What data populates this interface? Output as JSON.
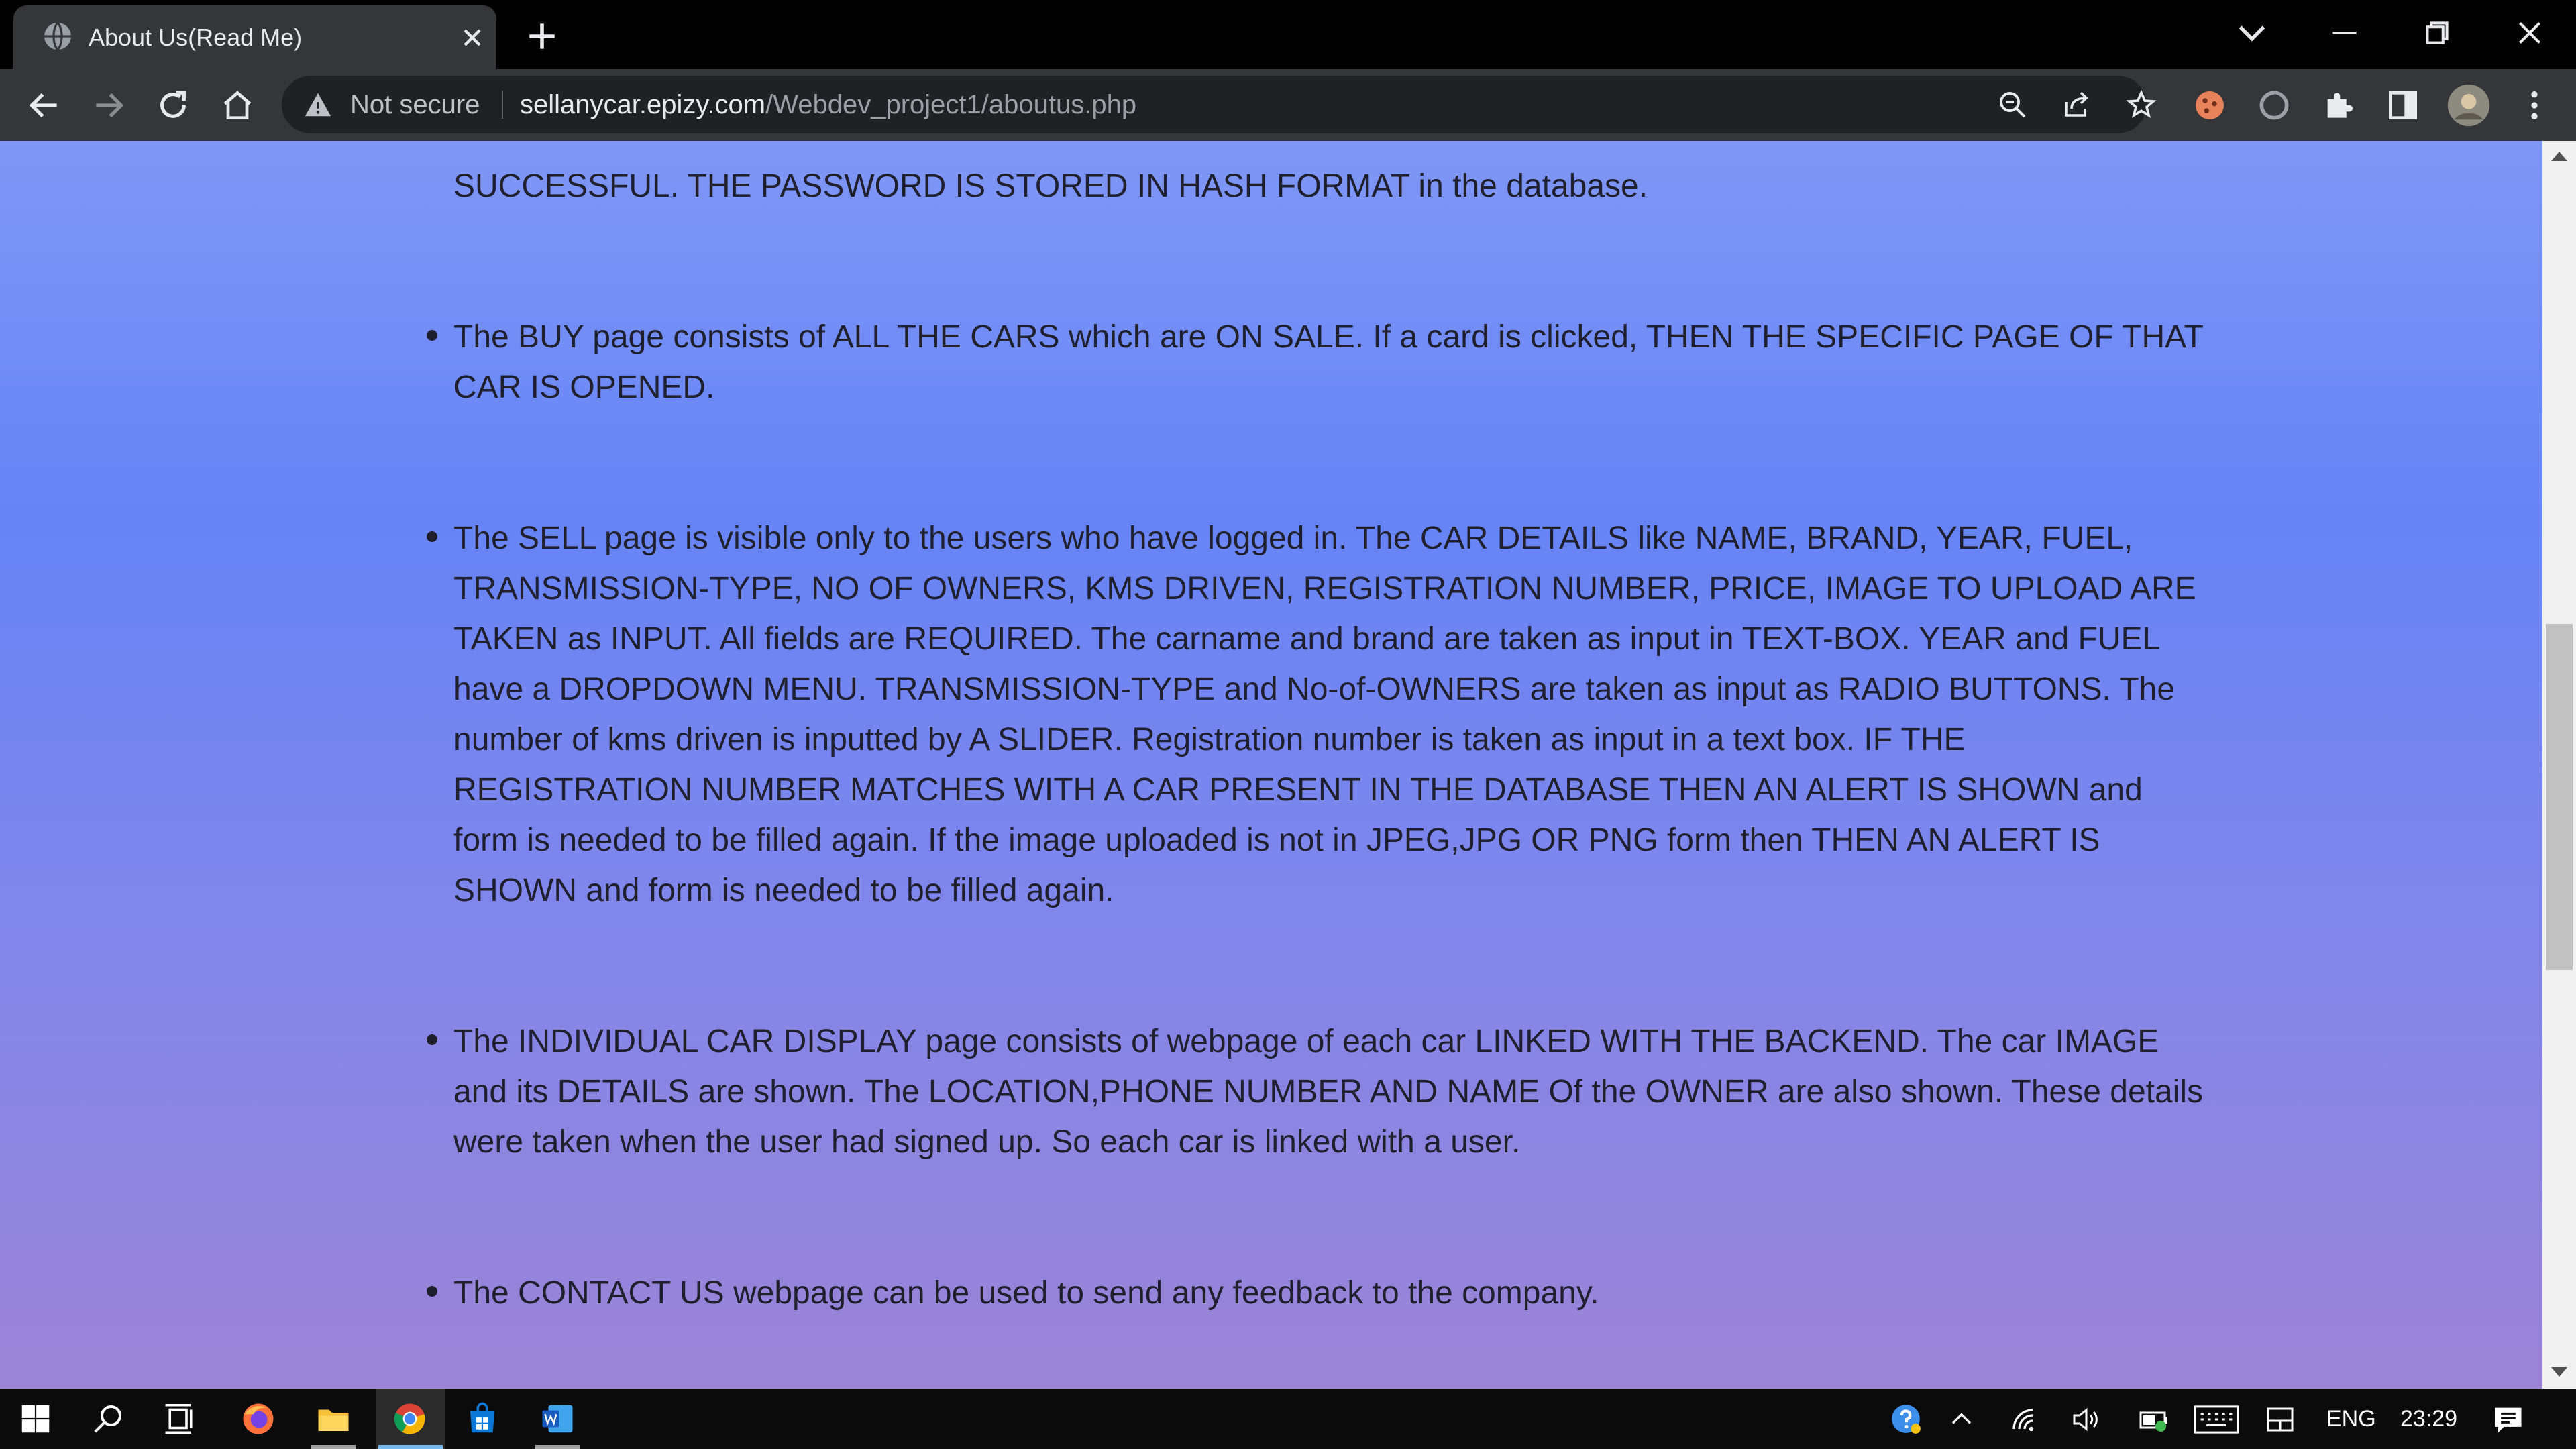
{
  "browser": {
    "tab": {
      "title": "About Us(Read Me)",
      "favicon": "globe-icon"
    },
    "new_tab_icon": "plus-icon",
    "window_controls": [
      "chevron-down-icon",
      "minimize-icon",
      "restore-icon",
      "close-icon"
    ],
    "toolbar": {
      "nav_icons": [
        "back-arrow-icon",
        "forward-arrow-icon",
        "reload-icon",
        "home-icon"
      ],
      "security_label": "Not secure",
      "url_host": "sellanycar.epizy.com",
      "url_path": "/Webdev_project1/aboutus.php",
      "omnibox_icons": [
        "zoom-out-icon",
        "share-icon",
        "star-icon"
      ],
      "extension_icons": [
        "cookie-extension-icon",
        "sync-extension-icon",
        "puzzle-icon",
        "side-panel-icon",
        "profile-avatar-icon",
        "kebab-menu-icon"
      ]
    }
  },
  "page": {
    "paragraphs": [
      {
        "bulleted": false,
        "text": "SUCCESSFUL. THE PASSWORD IS STORED IN HASH FORMAT in the database."
      },
      {
        "bulleted": true,
        "text": "The BUY page consists of ALL THE CARS which are ON SALE. If a card is clicked, THEN THE SPECIFIC PAGE OF THAT CAR IS OPENED."
      },
      {
        "bulleted": true,
        "text": "The SELL page is visible only to the users who have logged in. The CAR DETAILS like NAME, BRAND, YEAR, FUEL, TRANSMISSION-TYPE, NO OF OWNERS, KMS DRIVEN, REGISTRATION NUMBER, PRICE, IMAGE TO UPLOAD ARE TAKEN as INPUT. All fields are REQUIRED. The carname and brand are taken as input in TEXT-BOX. YEAR and FUEL have a DROPDOWN MENU. TRANSMISSION-TYPE and No-of-OWNERS are taken as input as RADIO BUTTONS. The number of kms driven is inputted by A SLIDER. Registration number is taken as input in a text box. IF THE REGISTRATION NUMBER MATCHES WITH A CAR PRESENT IN THE DATABASE THEN AN ALERT IS SHOWN and form is needed to be filled again. If the image uploaded is not in JPEG,JPG OR PNG form then THEN AN ALERT IS SHOWN and form is needed to be filled again."
      },
      {
        "bulleted": true,
        "text": "The INDIVIDUAL CAR DISPLAY page consists of webpage of each car LINKED WITH THE BACKEND. The car IMAGE and its DETAILS are shown. The LOCATION,PHONE NUMBER AND NAME Of the OWNER are also shown. These details were taken when the user had signed up. So each car is linked with a user."
      },
      {
        "bulleted": true,
        "text": "The CONTACT US webpage can be used to send any feedback to the company."
      }
    ],
    "scroll_position_fraction": 0.42
  },
  "taskbar": {
    "pinned_icons": [
      "windows-start-icon",
      "search-icon",
      "task-view-icon",
      "firefox-icon",
      "file-explorer-icon",
      "chrome-icon",
      "microsoft-store-icon",
      "word-icon"
    ],
    "tray_icons": [
      "help-icon",
      "chevron-up-icon",
      "wifi-icon",
      "volume-icon",
      "battery-icon",
      "keyboard-icon",
      "tablet-mode-icon"
    ],
    "language": "ENG",
    "time": "23:29",
    "notification_icon": "notification-icon"
  },
  "colors": {
    "titlebar": "#000000",
    "toolbar": "#35363a",
    "omnibox": "#202124",
    "page_gradient_top": "#7f97f5",
    "page_gradient_bottom": "#9b84d6",
    "text": "#1f1f2e",
    "taskbar": "#0b0b0b"
  }
}
